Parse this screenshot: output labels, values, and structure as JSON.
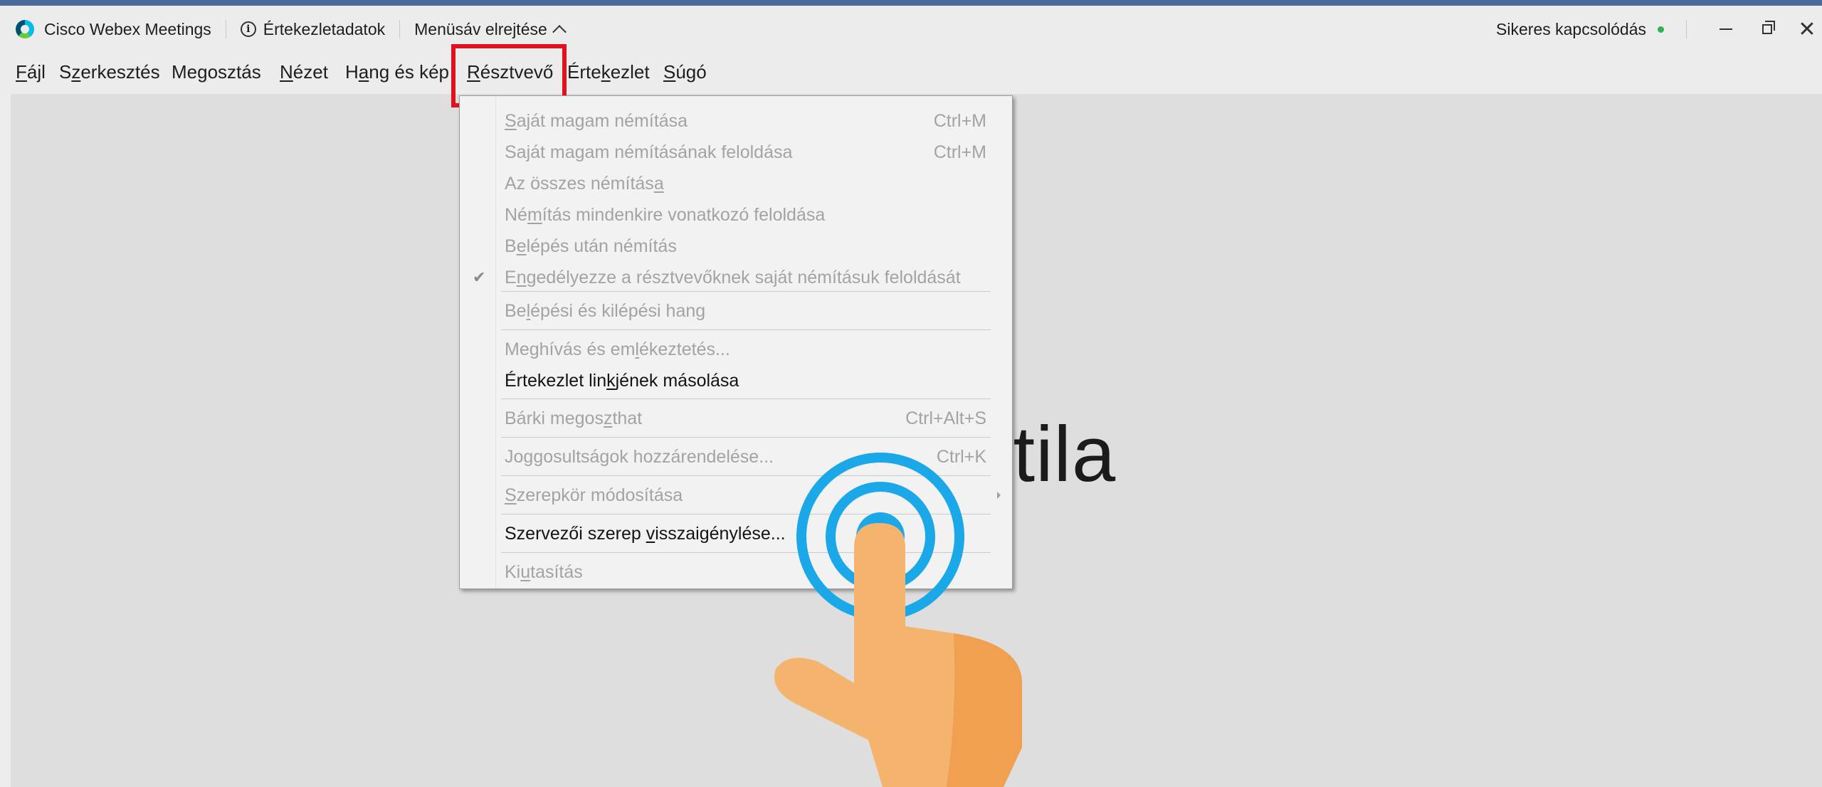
{
  "window": {
    "app_title": "Cisco Webex Meetings",
    "meeting_info": "Értekezletadatok",
    "hide_menu": "Menüsáv elrejtése",
    "connection_status": "Sikeres kapcsolódás",
    "status_color": "#2fb34a"
  },
  "menubar": {
    "items": [
      {
        "pre": "",
        "u": "F",
        "post": "ájl"
      },
      {
        "pre": "S",
        "u": "z",
        "post": "erkesztés"
      },
      {
        "pre": "Me",
        "u": "g",
        "post": "osztás"
      },
      {
        "pre": "",
        "u": "N",
        "post": "ézet"
      },
      {
        "pre": "H",
        "u": "a",
        "post": "ng és kép"
      },
      {
        "pre": "",
        "u": "R",
        "post": "észtvevő"
      },
      {
        "pre": "Érte",
        "u": "k",
        "post": "ezlet"
      },
      {
        "pre": "",
        "u": "S",
        "post": "úgó"
      }
    ],
    "highlight_color": "#e0121e"
  },
  "dropdown": {
    "items": [
      {
        "pre": "",
        "u": "S",
        "post": "aját magam némítása",
        "shortcut": "Ctrl+M",
        "enabled": false
      },
      {
        "pre": "Saját magam némításának feloldása",
        "u": "",
        "post": "",
        "shortcut": "Ctrl+M",
        "enabled": false
      },
      {
        "pre": "Az összes némítás",
        "u": "a",
        "post": "",
        "shortcut": "",
        "enabled": false
      },
      {
        "pre": "Né",
        "u": "m",
        "post": "ítás mindenkire vonatkozó feloldása",
        "shortcut": "",
        "enabled": false
      },
      {
        "pre": "B",
        "u": "e",
        "post": "lépés után némítás",
        "shortcut": "",
        "enabled": false
      },
      {
        "pre": "E",
        "u": "n",
        "post": "gedélyezze a résztvevőknek saját némításuk feloldását",
        "shortcut": "",
        "enabled": false,
        "checked": true
      },
      {
        "pre": "Be",
        "u": "l",
        "post": "épési és kilépési hang",
        "shortcut": "",
        "enabled": false
      },
      {
        "pre": "Meghívás és em",
        "u": "l",
        "post": "ékeztetés...",
        "shortcut": "",
        "enabled": false
      },
      {
        "pre": "Értekezlet lin",
        "u": "k",
        "post": "jének másolása",
        "shortcut": "",
        "enabled": true
      },
      {
        "pre": "Bárki megos",
        "u": "z",
        "post": "that",
        "shortcut": "Ctrl+Alt+S",
        "enabled": false
      },
      {
        "pre": "Jo",
        "u": "g",
        "post": "gosultságok hozzárendelése...",
        "shortcut": "Ctrl+K",
        "enabled": false
      },
      {
        "pre": "",
        "u": "S",
        "post": "zerepkör módosítása",
        "shortcut": "",
        "enabled": false,
        "submenu": true
      },
      {
        "pre": "Szervezői szerep ",
        "u": "v",
        "post": "isszaigénylése...",
        "shortcut": "",
        "enabled": true
      },
      {
        "pre": "Ki",
        "u": "u",
        "post": "tasítás",
        "shortcut": "",
        "enabled": false
      }
    ],
    "check_glyph": "✔"
  },
  "stage": {
    "participant_name_fragment": "ttila"
  },
  "gesture": {
    "icon": "tap-hand-icon",
    "ring_color": "#1aa8e8",
    "skin_color": "#f5b46e",
    "shade_color": "#f0a050"
  }
}
